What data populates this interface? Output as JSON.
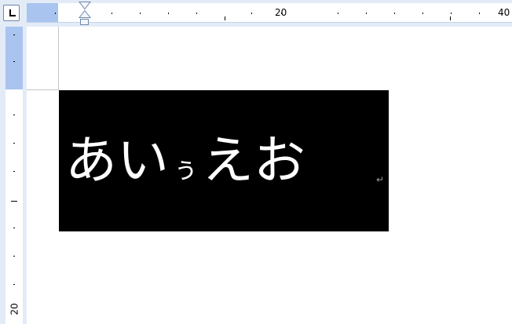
{
  "ruler": {
    "corner_tab_icon": "left-tab-icon",
    "horizontal_labels": [
      "20",
      "40"
    ],
    "vertical_labels": [
      "20"
    ],
    "margin_color": "#a9c4ee",
    "background_color": "#e3ebf7"
  },
  "document": {
    "textbox_text": [
      "あ",
      "い",
      "ぅ",
      "え",
      "お"
    ],
    "paragraph_mark": "↵",
    "textbox_background": "#000000",
    "text_color": "#ffffff"
  }
}
